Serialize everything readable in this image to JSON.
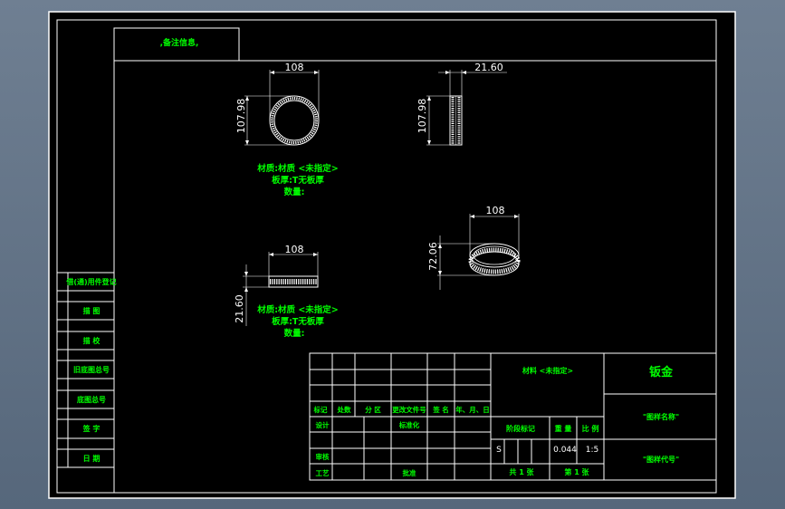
{
  "colors": {
    "background": "#000000",
    "frame": "#ffffff",
    "annotation": "#00ff00",
    "dimension": "#ffffff",
    "workspace": "#6a7b8e"
  },
  "drawing": {
    "note": ",备注信息,",
    "views": {
      "front": {
        "width_dim": "108",
        "height_dim": "107.98"
      },
      "side": {
        "width_dim": "21.60",
        "height_dim": "107.98"
      },
      "top": {
        "width_dim": "108",
        "height_dim": "21.60"
      },
      "iso": {
        "width_dim": "108",
        "height_dim": "72.06"
      }
    },
    "material_note_1": {
      "line1": "材质:材质 <未指定>",
      "line2": "板厚:T无板厚",
      "line3": "数量:"
    },
    "material_note_2": {
      "line1": "材质:材质 <未指定>",
      "line2": "板厚:T无板厚",
      "line3": "数量:"
    }
  },
  "left_strip": {
    "labels": [
      "借(通)用件登记",
      "描 图",
      "描 校",
      "旧底图总号",
      "底图总号",
      "签 字",
      "日 期"
    ]
  },
  "title_block": {
    "rev_headers": [
      "标记",
      "处数",
      "分 区",
      "更改文件号",
      "签 名",
      "年、月、日"
    ],
    "design": "设计",
    "standardize": "标准化",
    "review": "审核",
    "process": "工艺",
    "approve": "批准",
    "material": "材料 <未指定>",
    "company": "钣金",
    "stage_mark": "阶段标记",
    "weight_label": "重 量",
    "scale_label": "比 例",
    "stage_value": "S",
    "weight_value": "0.044",
    "scale_value": "1:5",
    "sheets_total": "共 1 张",
    "sheet_num": "第 1 张",
    "drawing_name": "\"图样名称\"",
    "drawing_code": "\"图样代号\""
  }
}
